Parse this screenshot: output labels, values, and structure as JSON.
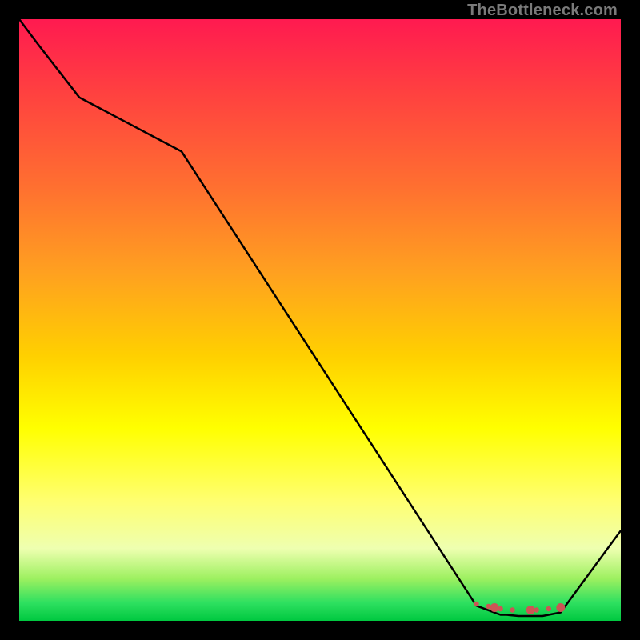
{
  "watermark": "TheBottleneck.com",
  "chart_data": {
    "type": "line",
    "title": "",
    "xlabel": "",
    "ylabel": "",
    "x": [
      0,
      3,
      10,
      27,
      76,
      80,
      81,
      83,
      84,
      86,
      87,
      88,
      90,
      100
    ],
    "values": [
      100,
      96,
      87,
      78,
      2.5,
      1,
      1,
      0.8,
      0.8,
      0.8,
      0.8,
      1,
      1.4,
      15
    ],
    "xlim": [
      0,
      100
    ],
    "ylim": [
      0,
      100
    ],
    "markers": {
      "x": [
        76,
        78,
        79,
        80,
        82,
        85,
        86,
        88,
        90
      ],
      "y": [
        2.8,
        2.4,
        2.2,
        2.0,
        1.8,
        1.8,
        1.8,
        2.0,
        2.2
      ],
      "color": "#cc5555",
      "size_pattern": "small-small-large"
    },
    "gradient_stops": [
      {
        "pos": 0.0,
        "color": "#ff1a50"
      },
      {
        "pos": 0.12,
        "color": "#ff4040"
      },
      {
        "pos": 0.28,
        "color": "#ff7030"
      },
      {
        "pos": 0.42,
        "color": "#ffa020"
      },
      {
        "pos": 0.56,
        "color": "#ffd000"
      },
      {
        "pos": 0.68,
        "color": "#ffff00"
      },
      {
        "pos": 0.8,
        "color": "#ffff70"
      },
      {
        "pos": 0.88,
        "color": "#eeffb0"
      },
      {
        "pos": 0.93,
        "color": "#9df060"
      },
      {
        "pos": 0.97,
        "color": "#2ee060"
      },
      {
        "pos": 1.0,
        "color": "#00c840"
      }
    ]
  }
}
